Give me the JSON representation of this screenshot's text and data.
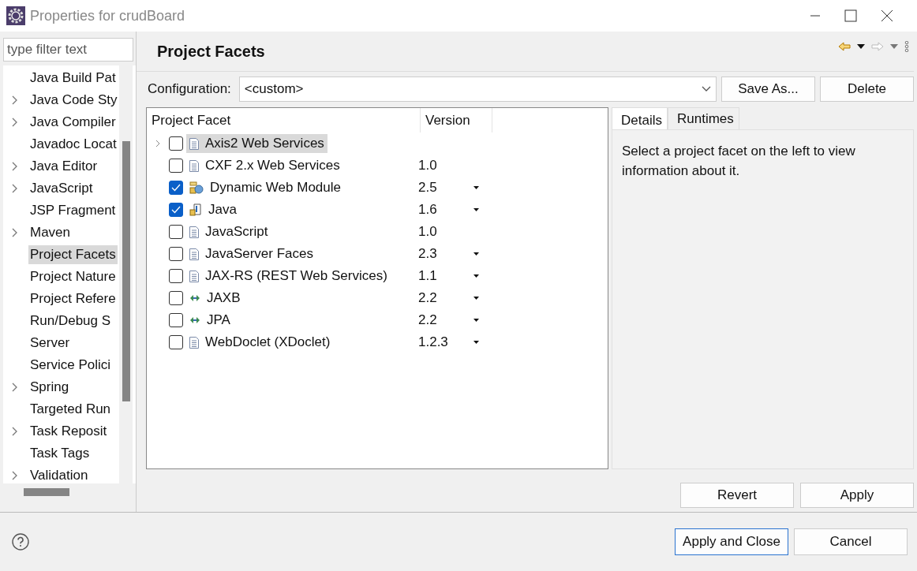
{
  "window": {
    "title": "Properties for crudBoard"
  },
  "sidebar": {
    "filter": {
      "placeholder": "type filter text"
    },
    "items": [
      {
        "label": "Java Build Pat",
        "kind": "page",
        "selected": false
      },
      {
        "label": "Java Code Sty",
        "kind": "group",
        "selected": false
      },
      {
        "label": "Java Compiler",
        "kind": "group",
        "selected": false
      },
      {
        "label": "Javadoc Locat",
        "kind": "page",
        "selected": false
      },
      {
        "label": "Java Editor",
        "kind": "group",
        "selected": false
      },
      {
        "label": "JavaScript",
        "kind": "group",
        "selected": false
      },
      {
        "label": "JSP Fragment",
        "kind": "page",
        "selected": false
      },
      {
        "label": "Maven",
        "kind": "group",
        "selected": false
      },
      {
        "label": "Project Facets",
        "kind": "page",
        "selected": true
      },
      {
        "label": "Project Nature",
        "kind": "page",
        "selected": false
      },
      {
        "label": "Project Refere",
        "kind": "page",
        "selected": false
      },
      {
        "label": "Run/Debug S",
        "kind": "page",
        "selected": false
      },
      {
        "label": "Server",
        "kind": "page",
        "selected": false
      },
      {
        "label": "Service Polici",
        "kind": "page",
        "selected": false
      },
      {
        "label": "Spring",
        "kind": "group",
        "selected": false
      },
      {
        "label": "Targeted Run",
        "kind": "page",
        "selected": false
      },
      {
        "label": "Task Reposit",
        "kind": "group",
        "selected": false
      },
      {
        "label": "Task Tags",
        "kind": "page",
        "selected": false
      },
      {
        "label": "Validation",
        "kind": "group",
        "selected": false
      }
    ]
  },
  "page": {
    "title": "Project Facets",
    "configuration": {
      "label": "Configuration:",
      "value": "<custom>",
      "buttons": [
        "Save As...",
        "Delete"
      ]
    },
    "table": {
      "columns": [
        "Project Facet",
        "Version"
      ],
      "rows": [
        {
          "name": "Axis2 Web Services",
          "kind": "document",
          "checked": false,
          "selected": true,
          "expandable": true,
          "has_dropdown": false
        },
        {
          "name": "CXF 2.x Web Services",
          "version": "1.0",
          "kind": "document",
          "checked": false,
          "selected": false,
          "expandable": false,
          "has_dropdown": false
        },
        {
          "name": "Dynamic Web Module",
          "version": "2.5",
          "kind": "module",
          "checked": true,
          "selected": false,
          "expandable": false,
          "has_dropdown": true
        },
        {
          "name": "Java",
          "version": "1.6",
          "kind": "java",
          "checked": true,
          "selected": false,
          "expandable": false,
          "has_dropdown": true
        },
        {
          "name": "JavaScript",
          "version": "1.0",
          "kind": "document",
          "checked": false,
          "selected": false,
          "expandable": false,
          "has_dropdown": false
        },
        {
          "name": "JavaServer Faces",
          "version": "2.3",
          "kind": "document",
          "checked": false,
          "selected": false,
          "expandable": false,
          "has_dropdown": true
        },
        {
          "name": "JAX-RS (REST Web Services)",
          "version": "1.1",
          "kind": "document",
          "checked": false,
          "selected": false,
          "expandable": false,
          "has_dropdown": true
        },
        {
          "name": "JAXB",
          "version": "2.2",
          "kind": "arrows",
          "checked": false,
          "selected": false,
          "expandable": false,
          "has_dropdown": true
        },
        {
          "name": "JPA",
          "version": "2.2",
          "kind": "arrows",
          "checked": false,
          "selected": false,
          "expandable": false,
          "has_dropdown": true
        },
        {
          "name": "WebDoclet (XDoclet)",
          "version": "1.2.3",
          "kind": "document",
          "checked": false,
          "selected": false,
          "expandable": false,
          "has_dropdown": true
        }
      ]
    },
    "tabs": [
      {
        "label": "Details",
        "selected": true
      },
      {
        "label": "Runtimes",
        "selected": false
      }
    ],
    "details_text": "Select a project facet on the left to view information about it.",
    "buttons": [
      "Revert",
      "Apply"
    ]
  },
  "footer": {
    "buttons": [
      {
        "label": "Apply and Close",
        "selected": true
      },
      {
        "label": "Cancel",
        "selected": false
      }
    ]
  }
}
